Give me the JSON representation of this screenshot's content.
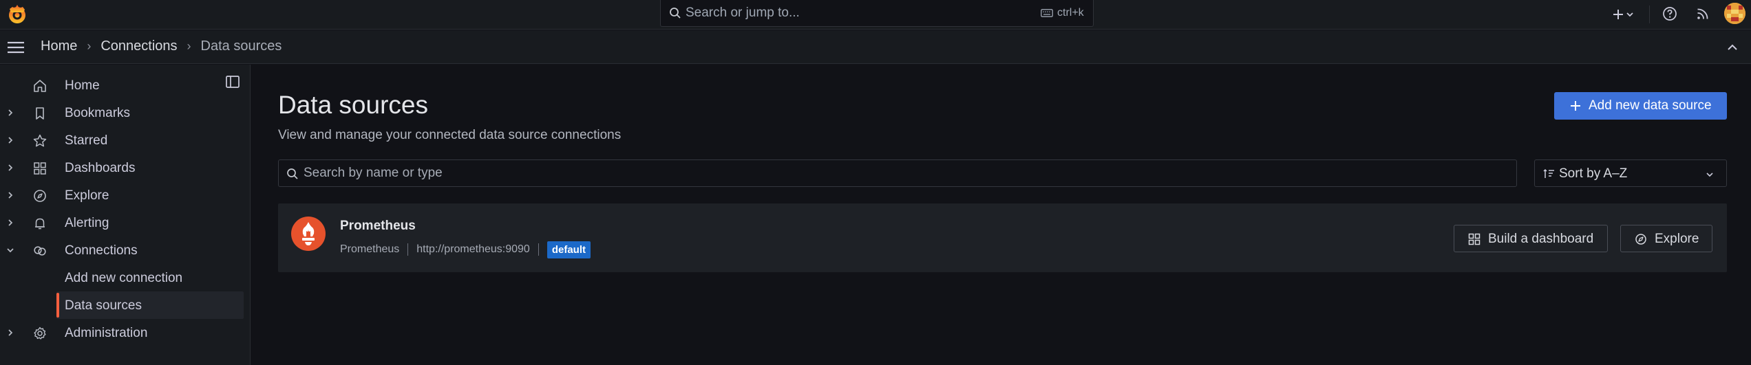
{
  "topbar": {
    "search": {
      "placeholder": "Search or jump to...",
      "shortcut": "ctrl+k"
    }
  },
  "breadcrumb": {
    "items": [
      "Home",
      "Connections",
      "Data sources"
    ],
    "separator": "›"
  },
  "sidebar": {
    "items": [
      {
        "label": "Home",
        "icon": "home-icon"
      },
      {
        "label": "Bookmarks",
        "icon": "bookmark-icon"
      },
      {
        "label": "Starred",
        "icon": "star-icon"
      },
      {
        "label": "Dashboards",
        "icon": "apps-icon"
      },
      {
        "label": "Explore",
        "icon": "compass-icon"
      },
      {
        "label": "Alerting",
        "icon": "bell-icon"
      },
      {
        "label": "Connections",
        "icon": "link-icon"
      },
      {
        "label": "Administration",
        "icon": "cog-icon"
      }
    ],
    "subitems": [
      {
        "label": "Add new connection"
      },
      {
        "label": "Data sources",
        "active": true
      }
    ]
  },
  "main": {
    "title": "Data sources",
    "subtitle": "View and manage your connected data source connections",
    "add_button": "Add new data source",
    "filter_placeholder": "Search by name or type",
    "sort_label": "Sort by A–Z"
  },
  "datasources": [
    {
      "name": "Prometheus",
      "type": "Prometheus",
      "url": "http://prometheus:9090",
      "badge": "default",
      "build_label": "Build a dashboard",
      "explore_label": "Explore"
    }
  ],
  "colors": {
    "accent": "#3d71d9",
    "active_indicator": "#f55f3e",
    "badge": "#1c69c8",
    "prometheus": "#e6522c"
  }
}
